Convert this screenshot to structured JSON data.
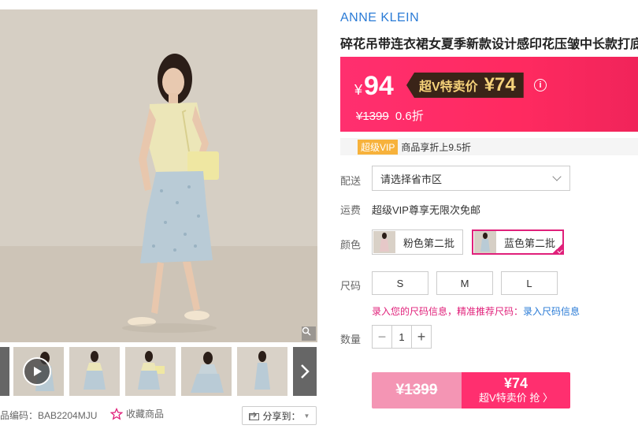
{
  "gallery": {
    "sku_code": "品编码：BAB2204MJU",
    "favorite_label": "收藏商品",
    "share_label": "分享到："
  },
  "product": {
    "brand": "ANNE KLEIN",
    "title": "碎花吊带连衣裙女夏季新款设计感印花压皱中长款打底"
  },
  "price": {
    "currency": "¥",
    "current": "94",
    "svip_label": "超V特卖价",
    "svip_price": "¥74",
    "original": "¥1399",
    "discount": "0.6折"
  },
  "vip": {
    "badge": "超级VIP",
    "text": "商品享折上9.5折"
  },
  "delivery": {
    "label": "配送",
    "placeholder": "请选择省市区"
  },
  "shipping": {
    "label": "运费",
    "text": "超级VIP尊享无限次免邮"
  },
  "color": {
    "label": "颜色",
    "options": [
      {
        "name": "粉色第二批",
        "selected": false
      },
      {
        "name": "蓝色第二批",
        "selected": true
      }
    ]
  },
  "size": {
    "label": "尺码",
    "options": [
      "S",
      "M",
      "L"
    ],
    "tip": "录入您的尺码信息，精准推荐尺码：",
    "tip_link": "录入尺码信息"
  },
  "quantity": {
    "label": "数量",
    "value": "1",
    "minus": "−",
    "plus": "+"
  },
  "buy": {
    "original_price": "¥1399",
    "vip_price": "¥74",
    "vip_action": "超V特卖价 抢 〉"
  },
  "colors": {
    "accent_pink": "#ff2f6f",
    "brand_blue": "#2a7bd6",
    "vip_gold": "#f7b23b"
  }
}
